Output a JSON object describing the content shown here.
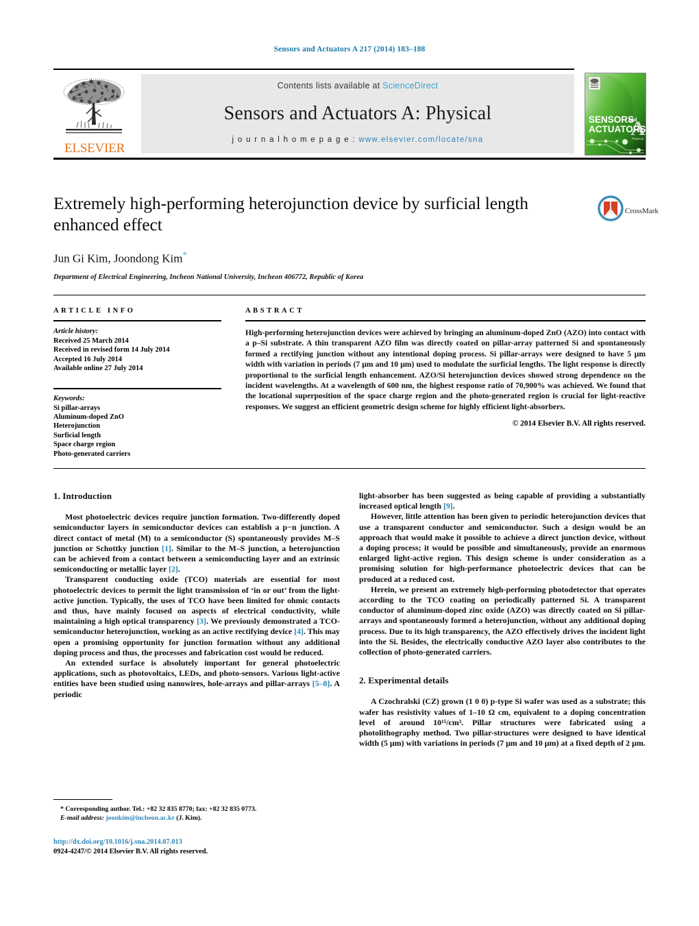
{
  "running_head": "Sensors and Actuators A 217 (2014) 183–188",
  "masthead": {
    "contents_prefix": "Contents lists available at ",
    "contents_link": "ScienceDirect",
    "journal_title": "Sensors and Actuators A: Physical",
    "homepage_prefix": "j o u r n a l   h o m e p a g e :",
    "homepage_url": "www.elsevier.com/locate/sna",
    "publisher": "ELSEVIER",
    "cover_line1": "SENSORS",
    "cover_line1_small": "and",
    "cover_line2": "ACTUATORS",
    "cover_letter": "A",
    "cover_sub": "Physical"
  },
  "article": {
    "title": "Extremely high-performing heterojunction device by surficial length enhanced effect",
    "authors": "Jun Gi Kim, Joondong Kim",
    "corresponding_mark": "*",
    "affiliation": "Department of Electrical Engineering, Incheon National University, Incheon 406772, Republic of Korea",
    "crossmark_label": "CrossMark"
  },
  "info": {
    "heading": "ARTICLE INFO",
    "history_label": "Article history:",
    "history": [
      "Received 25 March 2014",
      "Received in revised form 14 July 2014",
      "Accepted 16 July 2014",
      "Available online 27 July 2014"
    ],
    "keywords_label": "Keywords:",
    "keywords": [
      "Si pillar-arrays",
      "Aluminum-doped ZnO",
      "Heterojunction",
      "Surficial length",
      "Space charge region",
      "Photo-generated carriers"
    ]
  },
  "abstract": {
    "heading": "ABSTRACT",
    "text": "High-performing heterojunction devices were achieved by bringing an aluminum-doped ZnO (AZO) into contact with a p–Si substrate. A thin transparent AZO film was directly coated on pillar-array patterned Si and spontaneously formed a rectifying junction without any intentional doping process. Si pillar-arrays were designed to have 5 μm width with variation in periods (7 μm and 10 μm) used to modulate the surficial lengths. The light response is directly proportional to the surficial length enhancement. AZO/Si heterojunction devices showed strong dependence on the incident wavelengths. At a wavelength of 600 nm, the highest response ratio of 70,900% was achieved. We found that the locational superposition of the space charge region and the photo-generated region is crucial for light-reactive responses. We suggest an efficient geometric design scheme for highly efficient light-absorbers.",
    "copyright": "© 2014 Elsevier B.V. All rights reserved."
  },
  "sections": {
    "introduction_heading": "1. Introduction",
    "experimental_heading": "2. Experimental details",
    "intro_p1_a": "Most photoelectric devices require junction formation. Two-differently doped semiconductor layers in semiconductor devices can establish a p−n junction. A direct contact of metal (M) to a semiconductor (S) spontaneously provides M–S junction or Schottky junction ",
    "intro_p1_ref1": "[1]",
    "intro_p1_b": ". Similar to the M–S junction, a heterojunction can be achieved from a contact between a semiconducting layer and an extrinsic semiconducting or metallic layer ",
    "intro_p1_ref2": "[2]",
    "intro_p1_c": ".",
    "intro_p2_a": "Transparent conducting oxide (TCO) materials are essential for most photoelectric devices to permit the light transmission of ‘in or out’ from the light-active junction. Typically, the uses of TCO have been limited for ohmic contacts and thus, have mainly focused on aspects of electrical conductivity, while maintaining a high optical transparency ",
    "intro_p2_ref3": "[3]",
    "intro_p2_b": ". We previously demonstrated a TCO-semiconductor heterojunction, working as an active rectifying device ",
    "intro_p2_ref4": "[4]",
    "intro_p2_c": ". This may open a promising opportunity for junction formation without any additional doping process and thus, the processes and fabrication cost would be reduced.",
    "intro_p3_a": "An extended surface is absolutely important for general photoelectric applications, such as photovoltaics, LEDs, and photo-sensors. Various light-active entities have been studied using nanowires, hole-arrays and pillar-arrays ",
    "intro_p3_ref58": "[5–8]",
    "intro_p3_b": ". A periodic",
    "right_p1_a": "light-absorber has been suggested as being capable of providing a substantially increased optical length ",
    "right_p1_ref9": "[9]",
    "right_p1_b": ".",
    "right_p2": "However, little attention has been given to periodic heterojunction devices that use a transparent conductor and semiconductor. Such a design would be an approach that would make it possible to achieve a direct junction device, without a doping process; it would be possible and simultaneously, provide an enormous enlarged light-active region. This design scheme is under consideration as a promising solution for high-performance photoelectric devices that can be produced at a reduced cost.",
    "right_p3": "Herein, we present an extremely high-performing photodetector that operates according to the TCO coating on periodically patterned Si. A transparent conductor of aluminum-doped zinc oxide (AZO) was directly coated on Si pillar-arrays and spontaneously formed a heterojunction, without any additional doping process. Due to its high transparency, the AZO effectively drives the incident light into the Si. Besides, the electrically conductive AZO layer also contributes to the collection of photo-generated carriers.",
    "exp_p1": "A Czochralski (CZ) grown (1 0 0) p-type Si wafer was used as a substrate; this wafer has resistivity values of 1–10 Ω cm, equivalent to a doping concentration level of around 10¹⁵/cm³. Pillar structures were fabricated using a photolithography method. Two pillar-structures were designed to have identical width (5 μm) with variations in periods (7 μm and 10 μm) at a fixed depth of 2 μm."
  },
  "footnote": {
    "corresponding": "* Corresponding author. Tel.: +82 32 835 8770; fax: +82 32 835 0773.",
    "email_label": "E-mail address:",
    "email": "joonkim@incheon.ac.kr",
    "email_suffix": "(J. Kim)."
  },
  "footer": {
    "doi": "http://dx.doi.org/10.1016/j.sna.2014.07.013",
    "issn_line": "0924-4247/© 2014 Elsevier B.V. All rights reserved."
  },
  "colors": {
    "link_blue": "#2e86b8",
    "header_blue": "#1a7aa8",
    "elsevier_orange": "#e8721c",
    "band_grey": "#e8e8e8"
  }
}
